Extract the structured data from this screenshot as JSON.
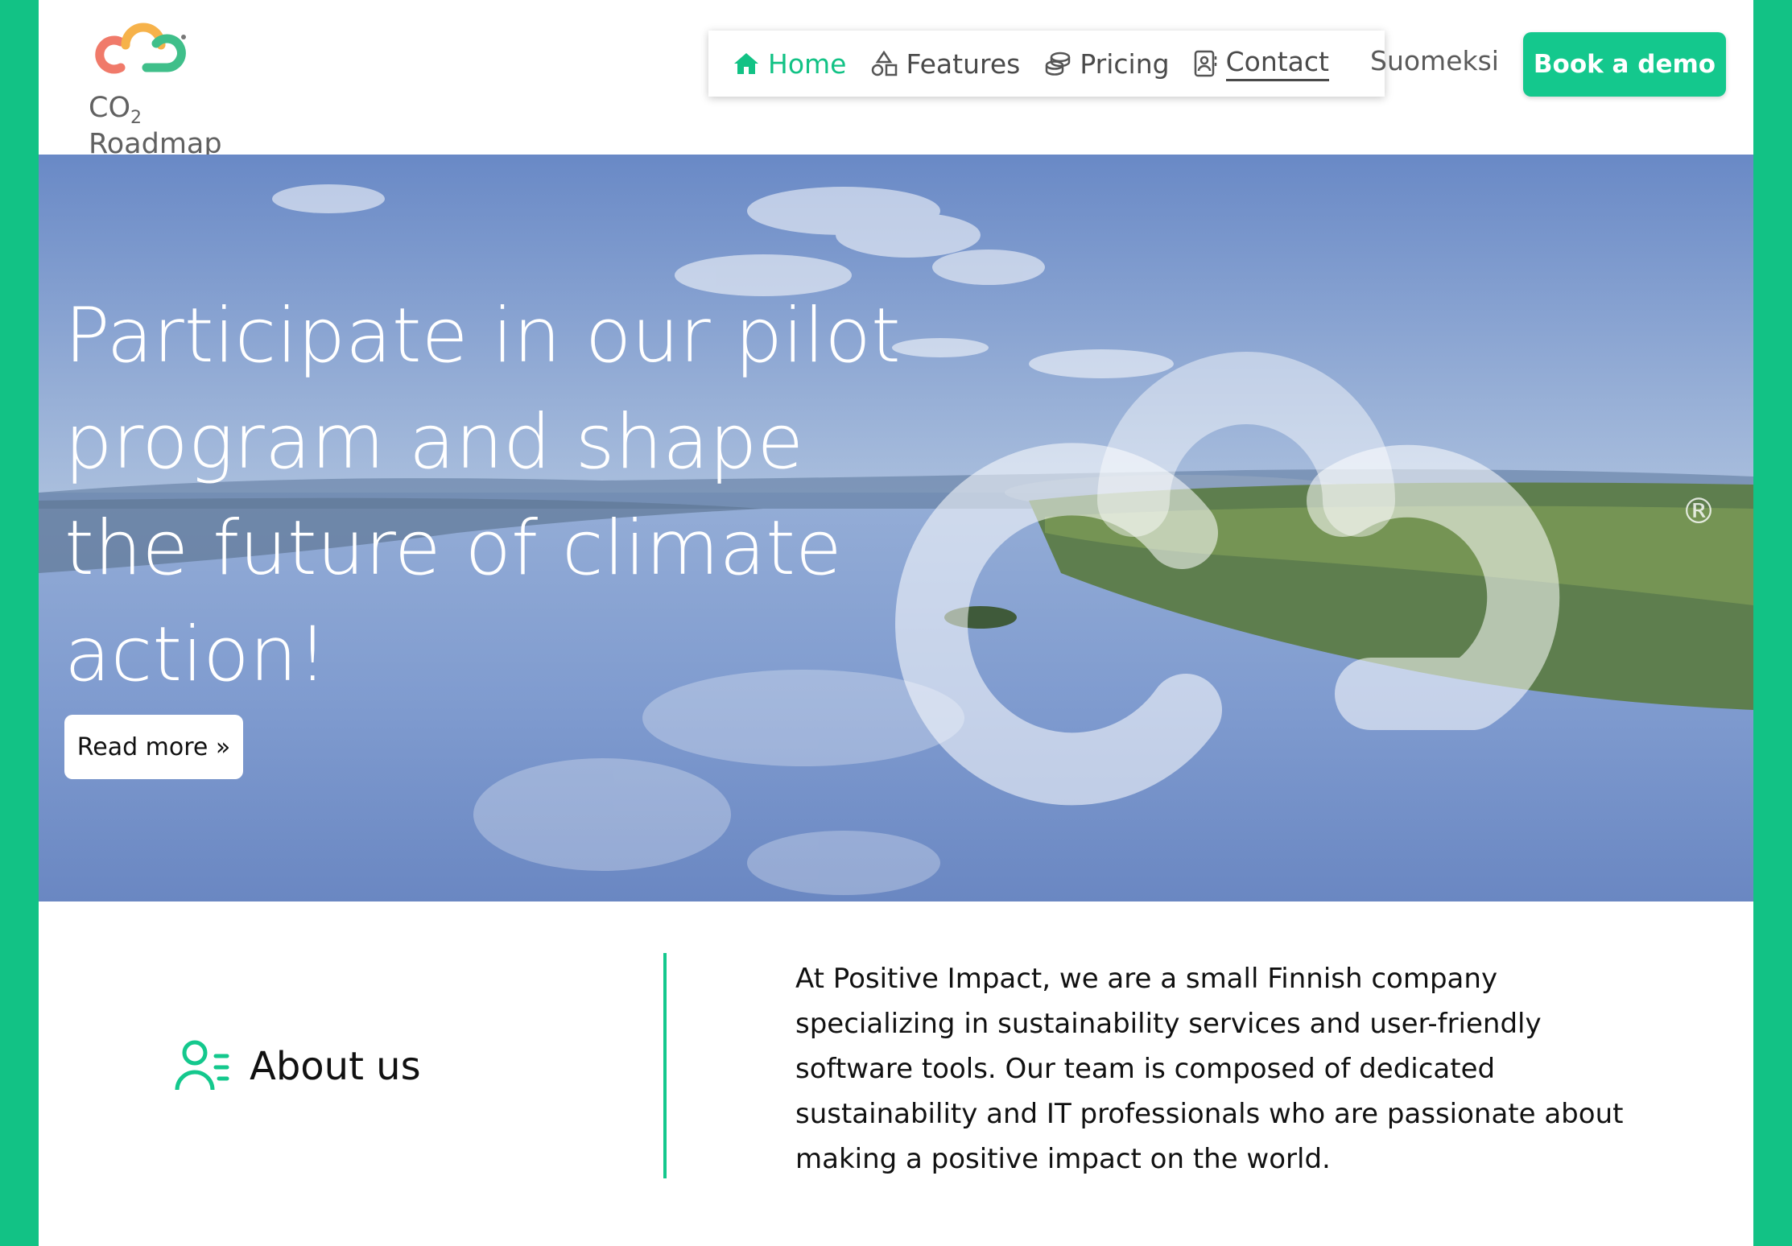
{
  "header": {
    "logo_text_main": "CO",
    "logo_text_sub": "2",
    "logo_text_rest": " Roadmap",
    "nav": [
      {
        "label": "Home",
        "icon": "home-icon",
        "active": true
      },
      {
        "label": "Features",
        "icon": "shapes-icon",
        "active": false
      },
      {
        "label": "Pricing",
        "icon": "coins-icon",
        "active": false
      },
      {
        "label": "Contact",
        "icon": "contact-card-icon",
        "active": false
      }
    ],
    "language_label": "Suomeksi",
    "demo_button_label": "Book a demo"
  },
  "hero": {
    "title": "Participate in our pilot program and shape the future of climate action!",
    "read_more_label": "Read more »",
    "registered_mark": "®"
  },
  "about": {
    "title": "About us",
    "icon": "team-list-icon",
    "text": "At Positive Impact, we are a small Finnish company specializing in sustainability services and user-friendly software tools. Our team is composed of dedicated sustainability and IT professionals who are passionate about making a positive impact on the world."
  },
  "colors": {
    "brand_green": "#14c88d",
    "page_border": "#12c285",
    "logo_red": "#f07a6a",
    "logo_orange": "#f6b24a",
    "logo_green": "#3fbf8a"
  }
}
